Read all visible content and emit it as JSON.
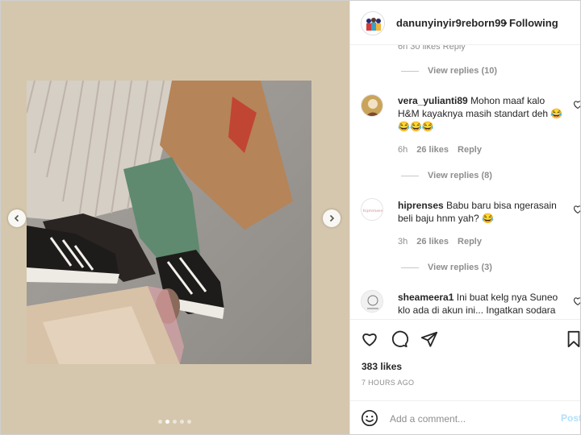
{
  "post": {
    "owner_username": "danunyinyir9reborn99",
    "header_separator": "•",
    "follow_status": "Following",
    "likes": "383 likes",
    "time_ago": "7 HOURS AGO",
    "carousel": {
      "total": 5,
      "active_index": 1
    }
  },
  "comments_top": {
    "previous_meta": "6h   30 likes   Reply",
    "view_replies_1": "View replies (10)"
  },
  "comments": [
    {
      "username": "vera_yulianti89",
      "text": "Mohon maaf kalo H&M kayaknya masih standart deh 😂😂😂😂",
      "time": "6h",
      "likes": "26 likes",
      "reply": "Reply",
      "view_replies": "View replies (8)"
    },
    {
      "username": "hiprenses",
      "text": "Babu baru bisa ngerasain beli baju hnm yah? 😂",
      "time": "3h",
      "likes": "26 likes",
      "reply": "Reply",
      "view_replies": "View replies (3)",
      "avatar_text": "hiprenses"
    },
    {
      "username": "sheameera1",
      "text": "Ini buat kelg nya Suneo klo ada di akun ini... Ingatkan sodara"
    }
  ],
  "composer": {
    "placeholder": "Add a comment...",
    "post_label": "Post"
  },
  "icons": {
    "like": "heart-icon",
    "comment": "comment-bubble-icon",
    "share": "paper-plane-icon",
    "save": "bookmark-icon",
    "emoji": "smiley-icon",
    "prev": "chevron-left-icon",
    "next": "chevron-right-icon"
  }
}
